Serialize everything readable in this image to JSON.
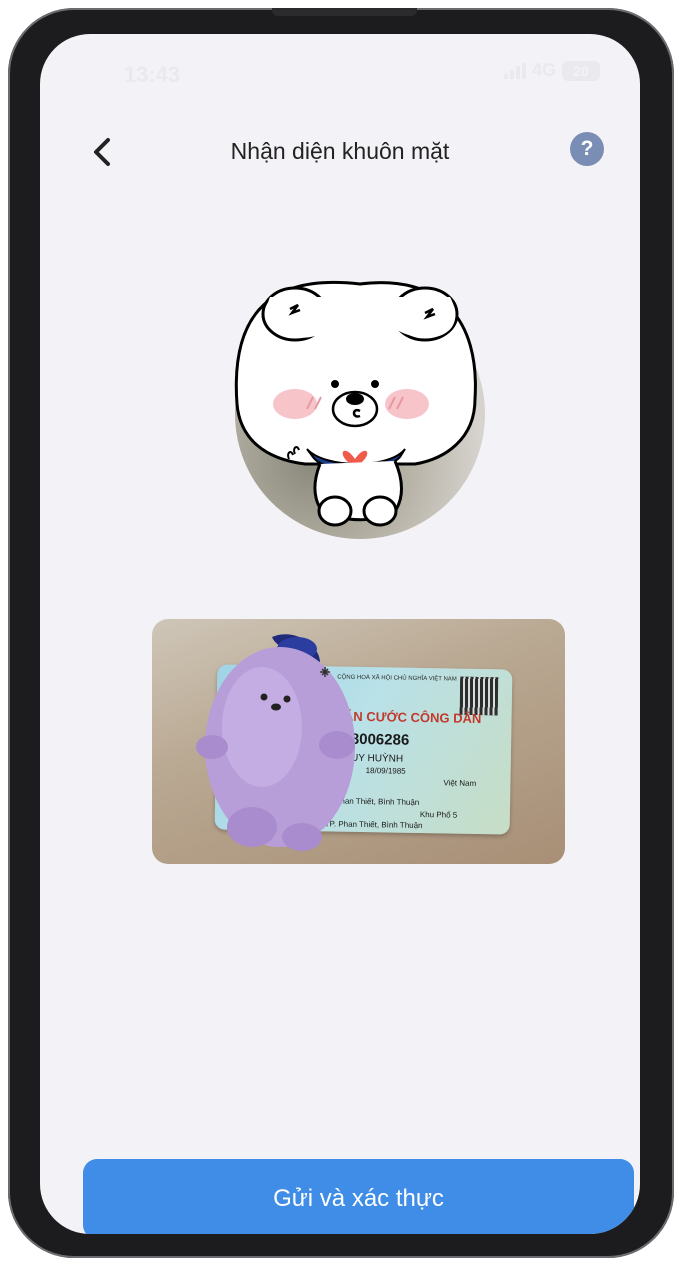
{
  "status_bar": {
    "time": "13:43",
    "network": "4G",
    "battery": "20"
  },
  "header": {
    "title": "Nhận diện khuôn mặt",
    "help_label": "?"
  },
  "id_card": {
    "header_line": "CỘNG HOÀ XÃ HỘI CHỦ NGHĨA VIỆT NAM",
    "title": "CĂN CƯỚC CÔNG DÂN",
    "id_number": "188006286",
    "name": "HUY HUỲNH",
    "dob": "18/09/1985",
    "nationality": "Việt Nam",
    "origin": "Phan Thiết, Bình Thuận",
    "residence_1": "Khu Phố 5",
    "residence_2": "TP. Phan Thiết, Bình Thuận"
  },
  "actions": {
    "submit_label": "Gửi và xác thực"
  },
  "colors": {
    "primary": "#3f8de6",
    "help": "#7a8db4",
    "background": "#f3f3f7"
  }
}
